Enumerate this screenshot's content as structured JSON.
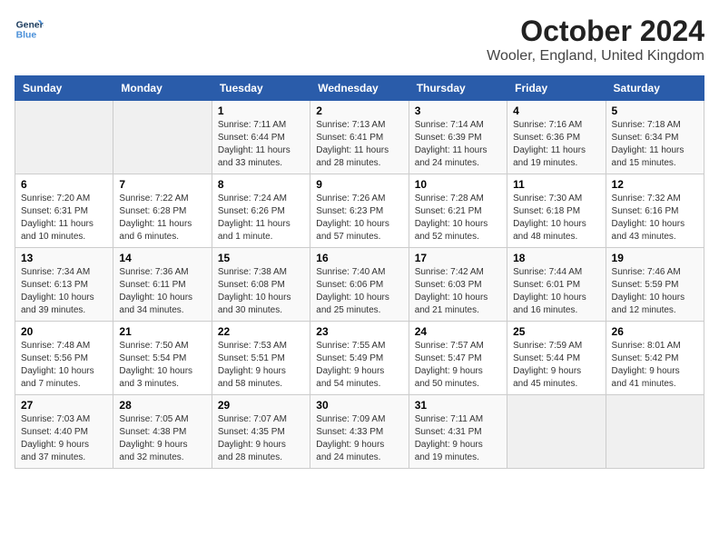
{
  "logo": {
    "line1": "General",
    "line2": "Blue"
  },
  "title": "October 2024",
  "subtitle": "Wooler, England, United Kingdom",
  "days_of_week": [
    "Sunday",
    "Monday",
    "Tuesday",
    "Wednesday",
    "Thursday",
    "Friday",
    "Saturday"
  ],
  "weeks": [
    [
      {
        "day": "",
        "info": ""
      },
      {
        "day": "",
        "info": ""
      },
      {
        "day": "1",
        "info": "Sunrise: 7:11 AM\nSunset: 6:44 PM\nDaylight: 11 hours\nand 33 minutes."
      },
      {
        "day": "2",
        "info": "Sunrise: 7:13 AM\nSunset: 6:41 PM\nDaylight: 11 hours\nand 28 minutes."
      },
      {
        "day": "3",
        "info": "Sunrise: 7:14 AM\nSunset: 6:39 PM\nDaylight: 11 hours\nand 24 minutes."
      },
      {
        "day": "4",
        "info": "Sunrise: 7:16 AM\nSunset: 6:36 PM\nDaylight: 11 hours\nand 19 minutes."
      },
      {
        "day": "5",
        "info": "Sunrise: 7:18 AM\nSunset: 6:34 PM\nDaylight: 11 hours\nand 15 minutes."
      }
    ],
    [
      {
        "day": "6",
        "info": "Sunrise: 7:20 AM\nSunset: 6:31 PM\nDaylight: 11 hours\nand 10 minutes."
      },
      {
        "day": "7",
        "info": "Sunrise: 7:22 AM\nSunset: 6:28 PM\nDaylight: 11 hours\nand 6 minutes."
      },
      {
        "day": "8",
        "info": "Sunrise: 7:24 AM\nSunset: 6:26 PM\nDaylight: 11 hours\nand 1 minute."
      },
      {
        "day": "9",
        "info": "Sunrise: 7:26 AM\nSunset: 6:23 PM\nDaylight: 10 hours\nand 57 minutes."
      },
      {
        "day": "10",
        "info": "Sunrise: 7:28 AM\nSunset: 6:21 PM\nDaylight: 10 hours\nand 52 minutes."
      },
      {
        "day": "11",
        "info": "Sunrise: 7:30 AM\nSunset: 6:18 PM\nDaylight: 10 hours\nand 48 minutes."
      },
      {
        "day": "12",
        "info": "Sunrise: 7:32 AM\nSunset: 6:16 PM\nDaylight: 10 hours\nand 43 minutes."
      }
    ],
    [
      {
        "day": "13",
        "info": "Sunrise: 7:34 AM\nSunset: 6:13 PM\nDaylight: 10 hours\nand 39 minutes."
      },
      {
        "day": "14",
        "info": "Sunrise: 7:36 AM\nSunset: 6:11 PM\nDaylight: 10 hours\nand 34 minutes."
      },
      {
        "day": "15",
        "info": "Sunrise: 7:38 AM\nSunset: 6:08 PM\nDaylight: 10 hours\nand 30 minutes."
      },
      {
        "day": "16",
        "info": "Sunrise: 7:40 AM\nSunset: 6:06 PM\nDaylight: 10 hours\nand 25 minutes."
      },
      {
        "day": "17",
        "info": "Sunrise: 7:42 AM\nSunset: 6:03 PM\nDaylight: 10 hours\nand 21 minutes."
      },
      {
        "day": "18",
        "info": "Sunrise: 7:44 AM\nSunset: 6:01 PM\nDaylight: 10 hours\nand 16 minutes."
      },
      {
        "day": "19",
        "info": "Sunrise: 7:46 AM\nSunset: 5:59 PM\nDaylight: 10 hours\nand 12 minutes."
      }
    ],
    [
      {
        "day": "20",
        "info": "Sunrise: 7:48 AM\nSunset: 5:56 PM\nDaylight: 10 hours\nand 7 minutes."
      },
      {
        "day": "21",
        "info": "Sunrise: 7:50 AM\nSunset: 5:54 PM\nDaylight: 10 hours\nand 3 minutes."
      },
      {
        "day": "22",
        "info": "Sunrise: 7:53 AM\nSunset: 5:51 PM\nDaylight: 9 hours\nand 58 minutes."
      },
      {
        "day": "23",
        "info": "Sunrise: 7:55 AM\nSunset: 5:49 PM\nDaylight: 9 hours\nand 54 minutes."
      },
      {
        "day": "24",
        "info": "Sunrise: 7:57 AM\nSunset: 5:47 PM\nDaylight: 9 hours\nand 50 minutes."
      },
      {
        "day": "25",
        "info": "Sunrise: 7:59 AM\nSunset: 5:44 PM\nDaylight: 9 hours\nand 45 minutes."
      },
      {
        "day": "26",
        "info": "Sunrise: 8:01 AM\nSunset: 5:42 PM\nDaylight: 9 hours\nand 41 minutes."
      }
    ],
    [
      {
        "day": "27",
        "info": "Sunrise: 7:03 AM\nSunset: 4:40 PM\nDaylight: 9 hours\nand 37 minutes."
      },
      {
        "day": "28",
        "info": "Sunrise: 7:05 AM\nSunset: 4:38 PM\nDaylight: 9 hours\nand 32 minutes."
      },
      {
        "day": "29",
        "info": "Sunrise: 7:07 AM\nSunset: 4:35 PM\nDaylight: 9 hours\nand 28 minutes."
      },
      {
        "day": "30",
        "info": "Sunrise: 7:09 AM\nSunset: 4:33 PM\nDaylight: 9 hours\nand 24 minutes."
      },
      {
        "day": "31",
        "info": "Sunrise: 7:11 AM\nSunset: 4:31 PM\nDaylight: 9 hours\nand 19 minutes."
      },
      {
        "day": "",
        "info": ""
      },
      {
        "day": "",
        "info": ""
      }
    ]
  ]
}
